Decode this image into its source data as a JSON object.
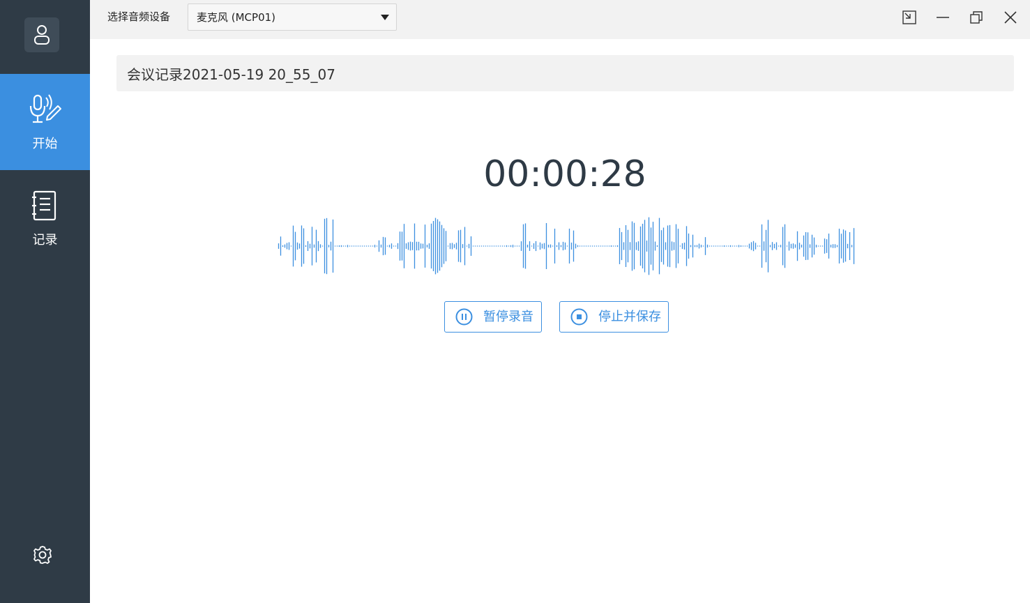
{
  "sidebar": {
    "avatar_icon": "user-icon",
    "items": [
      {
        "label": "开始",
        "icon": "mic-pen-icon",
        "active": true
      },
      {
        "label": "记录",
        "icon": "notebook-icon",
        "active": false
      }
    ],
    "settings_icon": "gear-icon"
  },
  "topbar": {
    "device_label": "选择音频设备",
    "device_selected": "麦克风 (MCP01)",
    "window_controls": [
      "fullscreen-exit-icon",
      "minimize-icon",
      "restore-icon",
      "close-icon"
    ]
  },
  "main": {
    "record_title": "会议记录2021-05-19 20_55_07",
    "timer": "00:00:28",
    "pause_button": "暂停录音",
    "stop_button": "停止并保存"
  },
  "colors": {
    "sidebar_bg": "#2f3b46",
    "accent": "#3b8fe0",
    "topbar_bg": "#f2f2f2",
    "timer_text": "#2e3a45"
  }
}
